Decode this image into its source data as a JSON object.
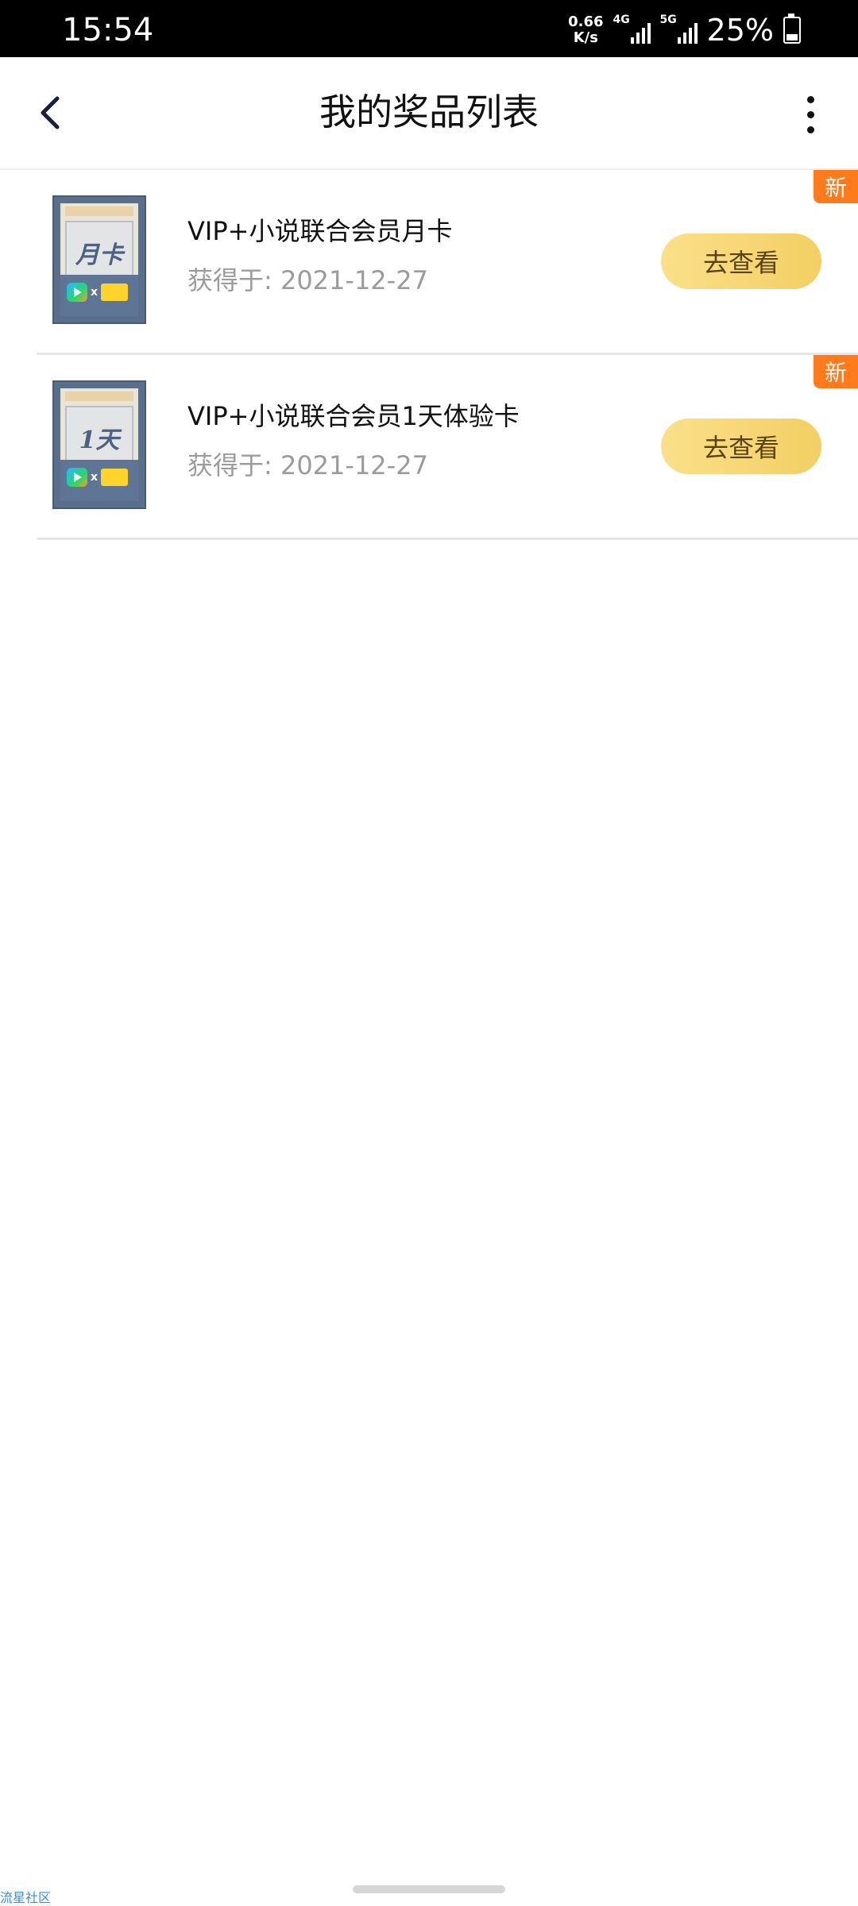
{
  "status_bar": {
    "time": "15:54",
    "net_speed_value": "0.66",
    "net_speed_unit": "K/s",
    "signal_1_label": "4G",
    "signal_2_label": "5G",
    "battery_percent": "25%"
  },
  "header": {
    "title": "我的奖品列表"
  },
  "prizes": [
    {
      "card_text": "月卡",
      "title": "VIP+小说联合会员月卡",
      "date": "获得于: 2021-12-27",
      "button_label": "去查看",
      "badge": "新"
    },
    {
      "card_text": "1天",
      "title": "VIP+小说联合会员1天体验卡",
      "date": "获得于: 2021-12-27",
      "button_label": "去查看",
      "badge": "新"
    }
  ],
  "footer": {
    "watermark": "流星社区"
  },
  "colors": {
    "accent_button": "#f3cf63",
    "badge": "#ff7a1a",
    "secondary_text": "#9b9b9b"
  }
}
